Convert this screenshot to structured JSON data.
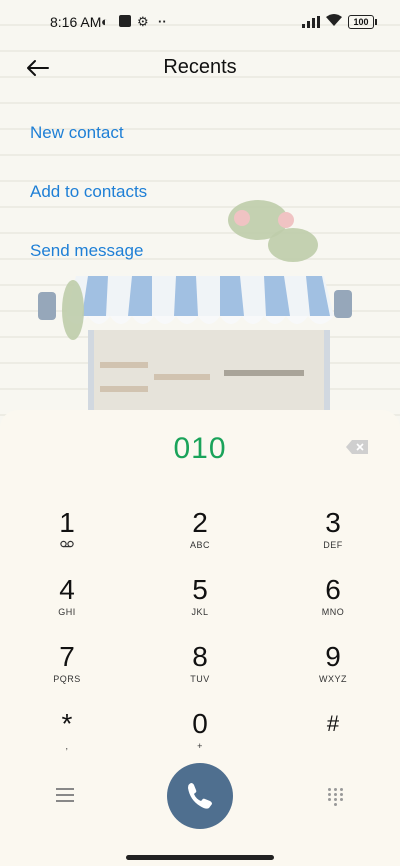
{
  "status_bar": {
    "time": "8:16 AM",
    "battery": "100",
    "more": "··"
  },
  "header": {
    "title": "Recents"
  },
  "actions": [
    {
      "label": "New contact"
    },
    {
      "label": "Add to contacts"
    },
    {
      "label": "Send message"
    }
  ],
  "dialer": {
    "number": "010",
    "keys": [
      {
        "digit": "1",
        "letters": "⌕"
      },
      {
        "digit": "2",
        "letters": "ABC"
      },
      {
        "digit": "3",
        "letters": "DEF"
      },
      {
        "digit": "4",
        "letters": "GHI"
      },
      {
        "digit": "5",
        "letters": "JKL"
      },
      {
        "digit": "6",
        "letters": "MNO"
      },
      {
        "digit": "7",
        "letters": "PQRS"
      },
      {
        "digit": "8",
        "letters": "TUV"
      },
      {
        "digit": "9",
        "letters": "WXYZ"
      },
      {
        "digit": "*",
        "letters": ","
      },
      {
        "digit": "0",
        "letters": "+"
      },
      {
        "digit": "#",
        "letters": ""
      }
    ]
  },
  "colors": {
    "accent": "#1e7fd6",
    "number": "#1aa35a",
    "call_button": "#4f6f8f"
  },
  "icons": [
    "back-arrow-icon",
    "backspace-icon",
    "menu-icon",
    "phone-icon",
    "keypad-icon",
    "voicemail-icon"
  ]
}
